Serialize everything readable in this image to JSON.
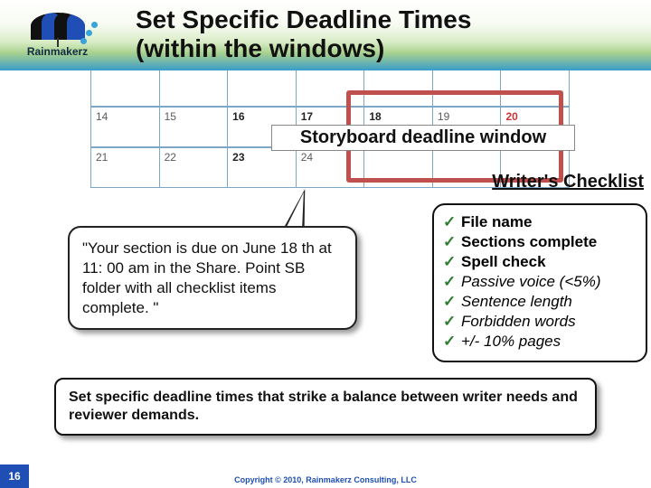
{
  "logo_text": "Rainmakerz",
  "title_line1": "Set Specific Deadline Times",
  "title_line2": "(within the windows)",
  "calendar": {
    "row1": [
      "",
      "",
      "",
      "",
      "",
      "",
      ""
    ],
    "row2": [
      "14",
      "15",
      "16",
      "17",
      "18",
      "19",
      "20"
    ],
    "row3": [
      "21",
      "22",
      "23",
      "24",
      "",
      "",
      ""
    ]
  },
  "window_label": "Storyboard deadline window",
  "checklist_heading": "Writer's Checklist",
  "bubble_text": "\"Your section is due on June 18 th at 11: 00 am in the Share. Point SB folder with all checklist items complete. \"",
  "checklist_items": [
    {
      "text": "File name",
      "style": "bold"
    },
    {
      "text": "Sections complete",
      "style": "bold"
    },
    {
      "text": "Spell check",
      "style": "bold"
    },
    {
      "text": "Passive voice (<5%)",
      "style": "italic"
    },
    {
      "text": "Sentence length",
      "style": "italic"
    },
    {
      "text": "Forbidden words",
      "style": "italic"
    },
    {
      "text": "+/- 10% pages",
      "style": "italic"
    }
  ],
  "summary": "Set specific deadline times that strike a balance between writer needs and reviewer demands.",
  "page_number": "16",
  "copyright": "Copyright © 2010, Rainmakerz Consulting, LLC"
}
